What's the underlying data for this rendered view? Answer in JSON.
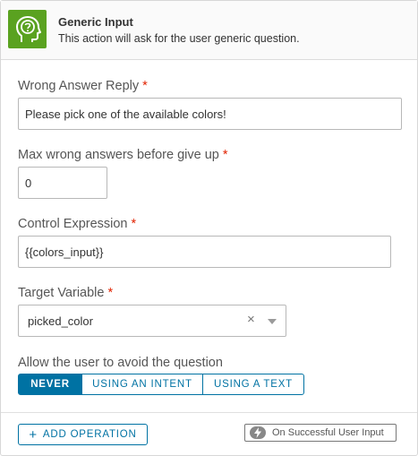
{
  "header": {
    "title": "Generic Input",
    "description": "This action will ask for the user generic question.",
    "icon": "head-question-icon",
    "icon_color": "#5aa220"
  },
  "fields": {
    "wrong_answer": {
      "label": "Wrong Answer Reply",
      "required_mark": "*",
      "value": "Please pick one of the available colors!"
    },
    "max_wrong": {
      "label": "Max wrong answers before give up",
      "required_mark": "*",
      "value": "0"
    },
    "control_expression": {
      "label": "Control Expression",
      "required_mark": "*",
      "value": "{{colors_input}}"
    },
    "target_variable": {
      "label": "Target Variable",
      "required_mark": "*",
      "value": "picked_color",
      "clear_icon": "×"
    }
  },
  "avoid": {
    "label": "Allow the user to avoid the question",
    "options": [
      "NEVER",
      "USING AN INTENT",
      "USING A TEXT"
    ],
    "selected": "NEVER"
  },
  "footer": {
    "add_operation_plus": "+",
    "add_operation_label": "ADD OPERATION",
    "trigger_label": "On Successful User Input",
    "trigger_icon": "lightning-icon"
  },
  "colors": {
    "accent": "#0072a3",
    "required": "#e12200"
  }
}
